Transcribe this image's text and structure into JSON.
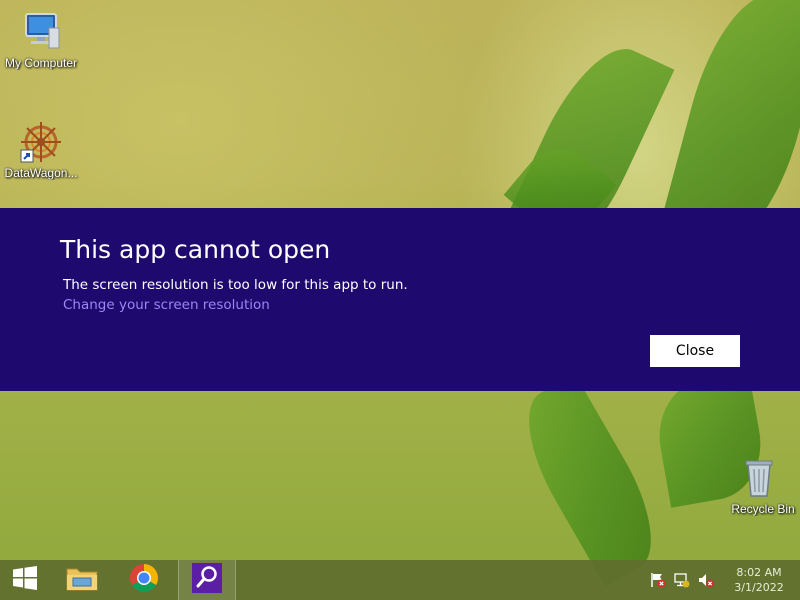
{
  "desktop": {
    "icons": [
      {
        "label": "My Computer",
        "icon": "computer-icon"
      },
      {
        "label": "DataWagon...",
        "icon": "datawagon-shortcut-icon"
      },
      {
        "label": "Recycle Bin",
        "icon": "recycle-bin-icon"
      }
    ]
  },
  "dialog": {
    "title": "This app cannot open",
    "message": "The screen resolution is too low for this app to run.",
    "link": "Change your screen resolution",
    "close_label": "Close",
    "background_color": "#1e0a6e",
    "link_color": "#9a86f5"
  },
  "taskbar": {
    "items": [
      {
        "icon": "windows-start-icon"
      },
      {
        "icon": "file-explorer-icon"
      },
      {
        "icon": "chrome-icon"
      },
      {
        "icon": "search-app-icon"
      }
    ],
    "tray": [
      {
        "icon": "action-center-flag-icon"
      },
      {
        "icon": "network-icon"
      },
      {
        "icon": "volume-muted-icon"
      }
    ],
    "clock": {
      "time": "8:02 AM",
      "date": "3/1/2022"
    }
  }
}
